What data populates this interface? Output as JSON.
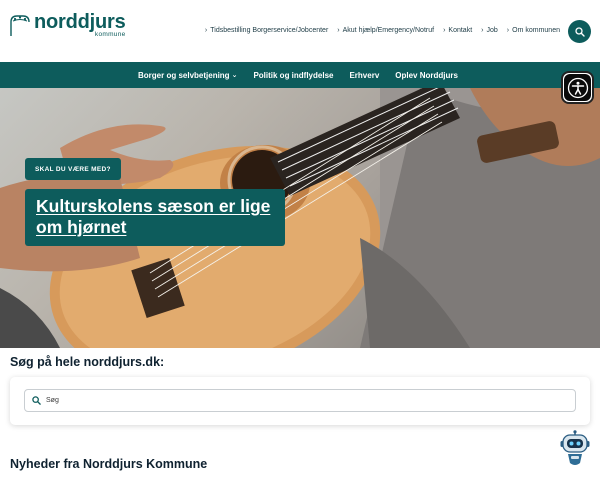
{
  "header": {
    "logo_text": "norddjurs",
    "logo_sub": "kommune",
    "util_links": [
      "Tidsbestilling Borgerservice/Jobcenter",
      "Akut hjælp/Emergency/Notruf",
      "Kontakt",
      "Job",
      "Om kommunen"
    ],
    "search_icon": "search-icon"
  },
  "nav": {
    "items": [
      {
        "label": "Borger og selvbetjening",
        "has_dropdown": true
      },
      {
        "label": "Politik og indflydelse",
        "has_dropdown": false
      },
      {
        "label": "Erhverv",
        "has_dropdown": false
      },
      {
        "label": "Oplev Norddjurs",
        "has_dropdown": false
      }
    ],
    "accessibility_icon": "accessibility-icon"
  },
  "hero": {
    "tag": "SKAL DU VÆRE MED?",
    "title": "Kulturskolens sæson er lige om hjørnet"
  },
  "search": {
    "heading": "Søg på hele norddjurs.dk:",
    "placeholder": "Søg",
    "value": ""
  },
  "news": {
    "heading": "Nyheder fra Norddjurs Kommune"
  },
  "colors": {
    "brand": "#0d5c5c",
    "text_dark": "#0f2230",
    "white": "#ffffff"
  }
}
